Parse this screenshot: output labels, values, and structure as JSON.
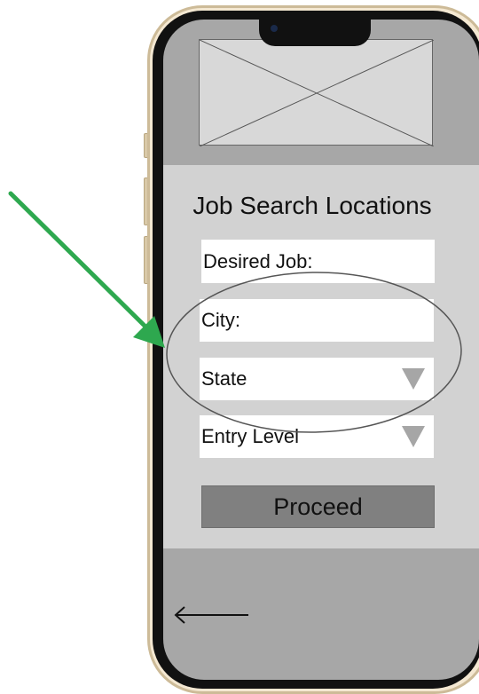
{
  "screen": {
    "title": "Job Search Locations",
    "fields": {
      "desired_job": "Desired Job:",
      "city": "City:",
      "state": "State",
      "level": "Entry Level"
    },
    "proceed_label": "Proceed"
  },
  "colors": {
    "annotation_arrow": "#2ea84f",
    "panel": "#d2d2d2",
    "button": "#808080"
  }
}
